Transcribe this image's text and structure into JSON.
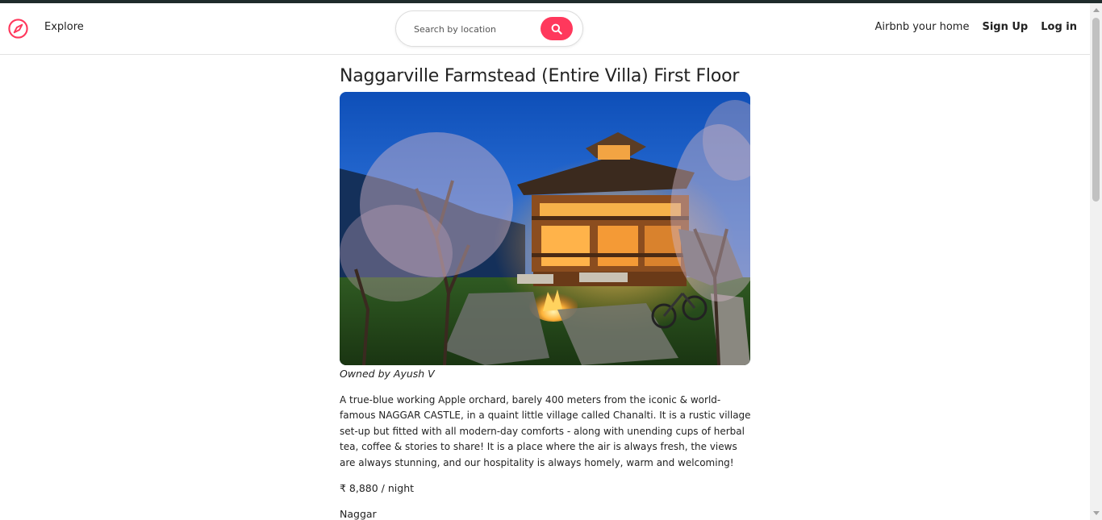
{
  "colors": {
    "brand": "#ff385c",
    "text": "#222222",
    "border": "#dddddd"
  },
  "navbar": {
    "logo_icon": "compass-icon",
    "explore_label": "Explore",
    "search": {
      "placeholder": "Search by location",
      "button_icon": "search-icon"
    },
    "host_label": "Airbnb your home",
    "signup_label": "Sign Up",
    "login_label": "Log in"
  },
  "listing": {
    "title": "Naggarville Farmstead (Entire Villa) First Floor",
    "photo_description": "wooden villa lit at dusk with bonfire, benches, bicycle and apple orchard trees",
    "owner": "Owned by Ayush V",
    "description": "A true-blue working Apple orchard, barely 400 meters from the iconic & world-famous NAGGAR CASTLE, in a quaint little village called Chanalti. It is a rustic village set-up but fitted with all modern-day comforts - along with unending cups of herbal tea, coffee & stories to share! It is a place where the air is always fresh, the views are always stunning, and our hospitality is always homely, warm and welcoming!",
    "price": "₹ 8,880 / night",
    "location": "Naggar"
  }
}
